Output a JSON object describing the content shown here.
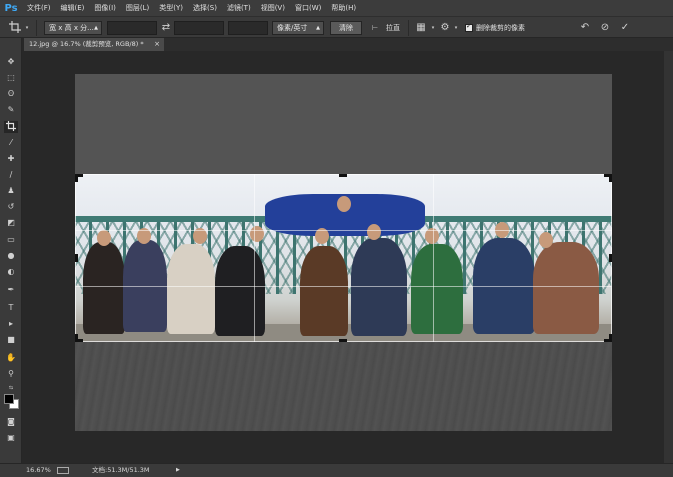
{
  "app": {
    "logo": "Ps"
  },
  "menu": [
    "文件(F)",
    "编辑(E)",
    "图像(I)",
    "图层(L)",
    "类型(Y)",
    "选择(S)",
    "滤镜(T)",
    "视图(V)",
    "窗口(W)",
    "帮助(H)"
  ],
  "options": {
    "ratio_dropdown": "宽 x 高 x 分...",
    "unit_dropdown": "像素/英寸",
    "clear_button": "清除",
    "straighten_label": "拉直",
    "delete_cropped_checkbox_label": "删除裁剪的像素",
    "delete_cropped_checked": true
  },
  "document": {
    "tab_title": "12.jpg @ 16.7% (裁剪预览, RGB/8) *",
    "close_glyph": "×"
  },
  "status": {
    "zoom": "16.67%",
    "doc_info": "文档:51.3M/51.3M",
    "arrow": "▶"
  },
  "colors": {
    "foreground": "#000000",
    "background": "#ffffff",
    "accent": "#3fa9f5"
  },
  "icons": {
    "undo": "↶",
    "cancel": "⊘",
    "commit": "✓",
    "settings": "⚙",
    "swap": "⇄",
    "grid": "▦",
    "straighten": "⊢"
  }
}
